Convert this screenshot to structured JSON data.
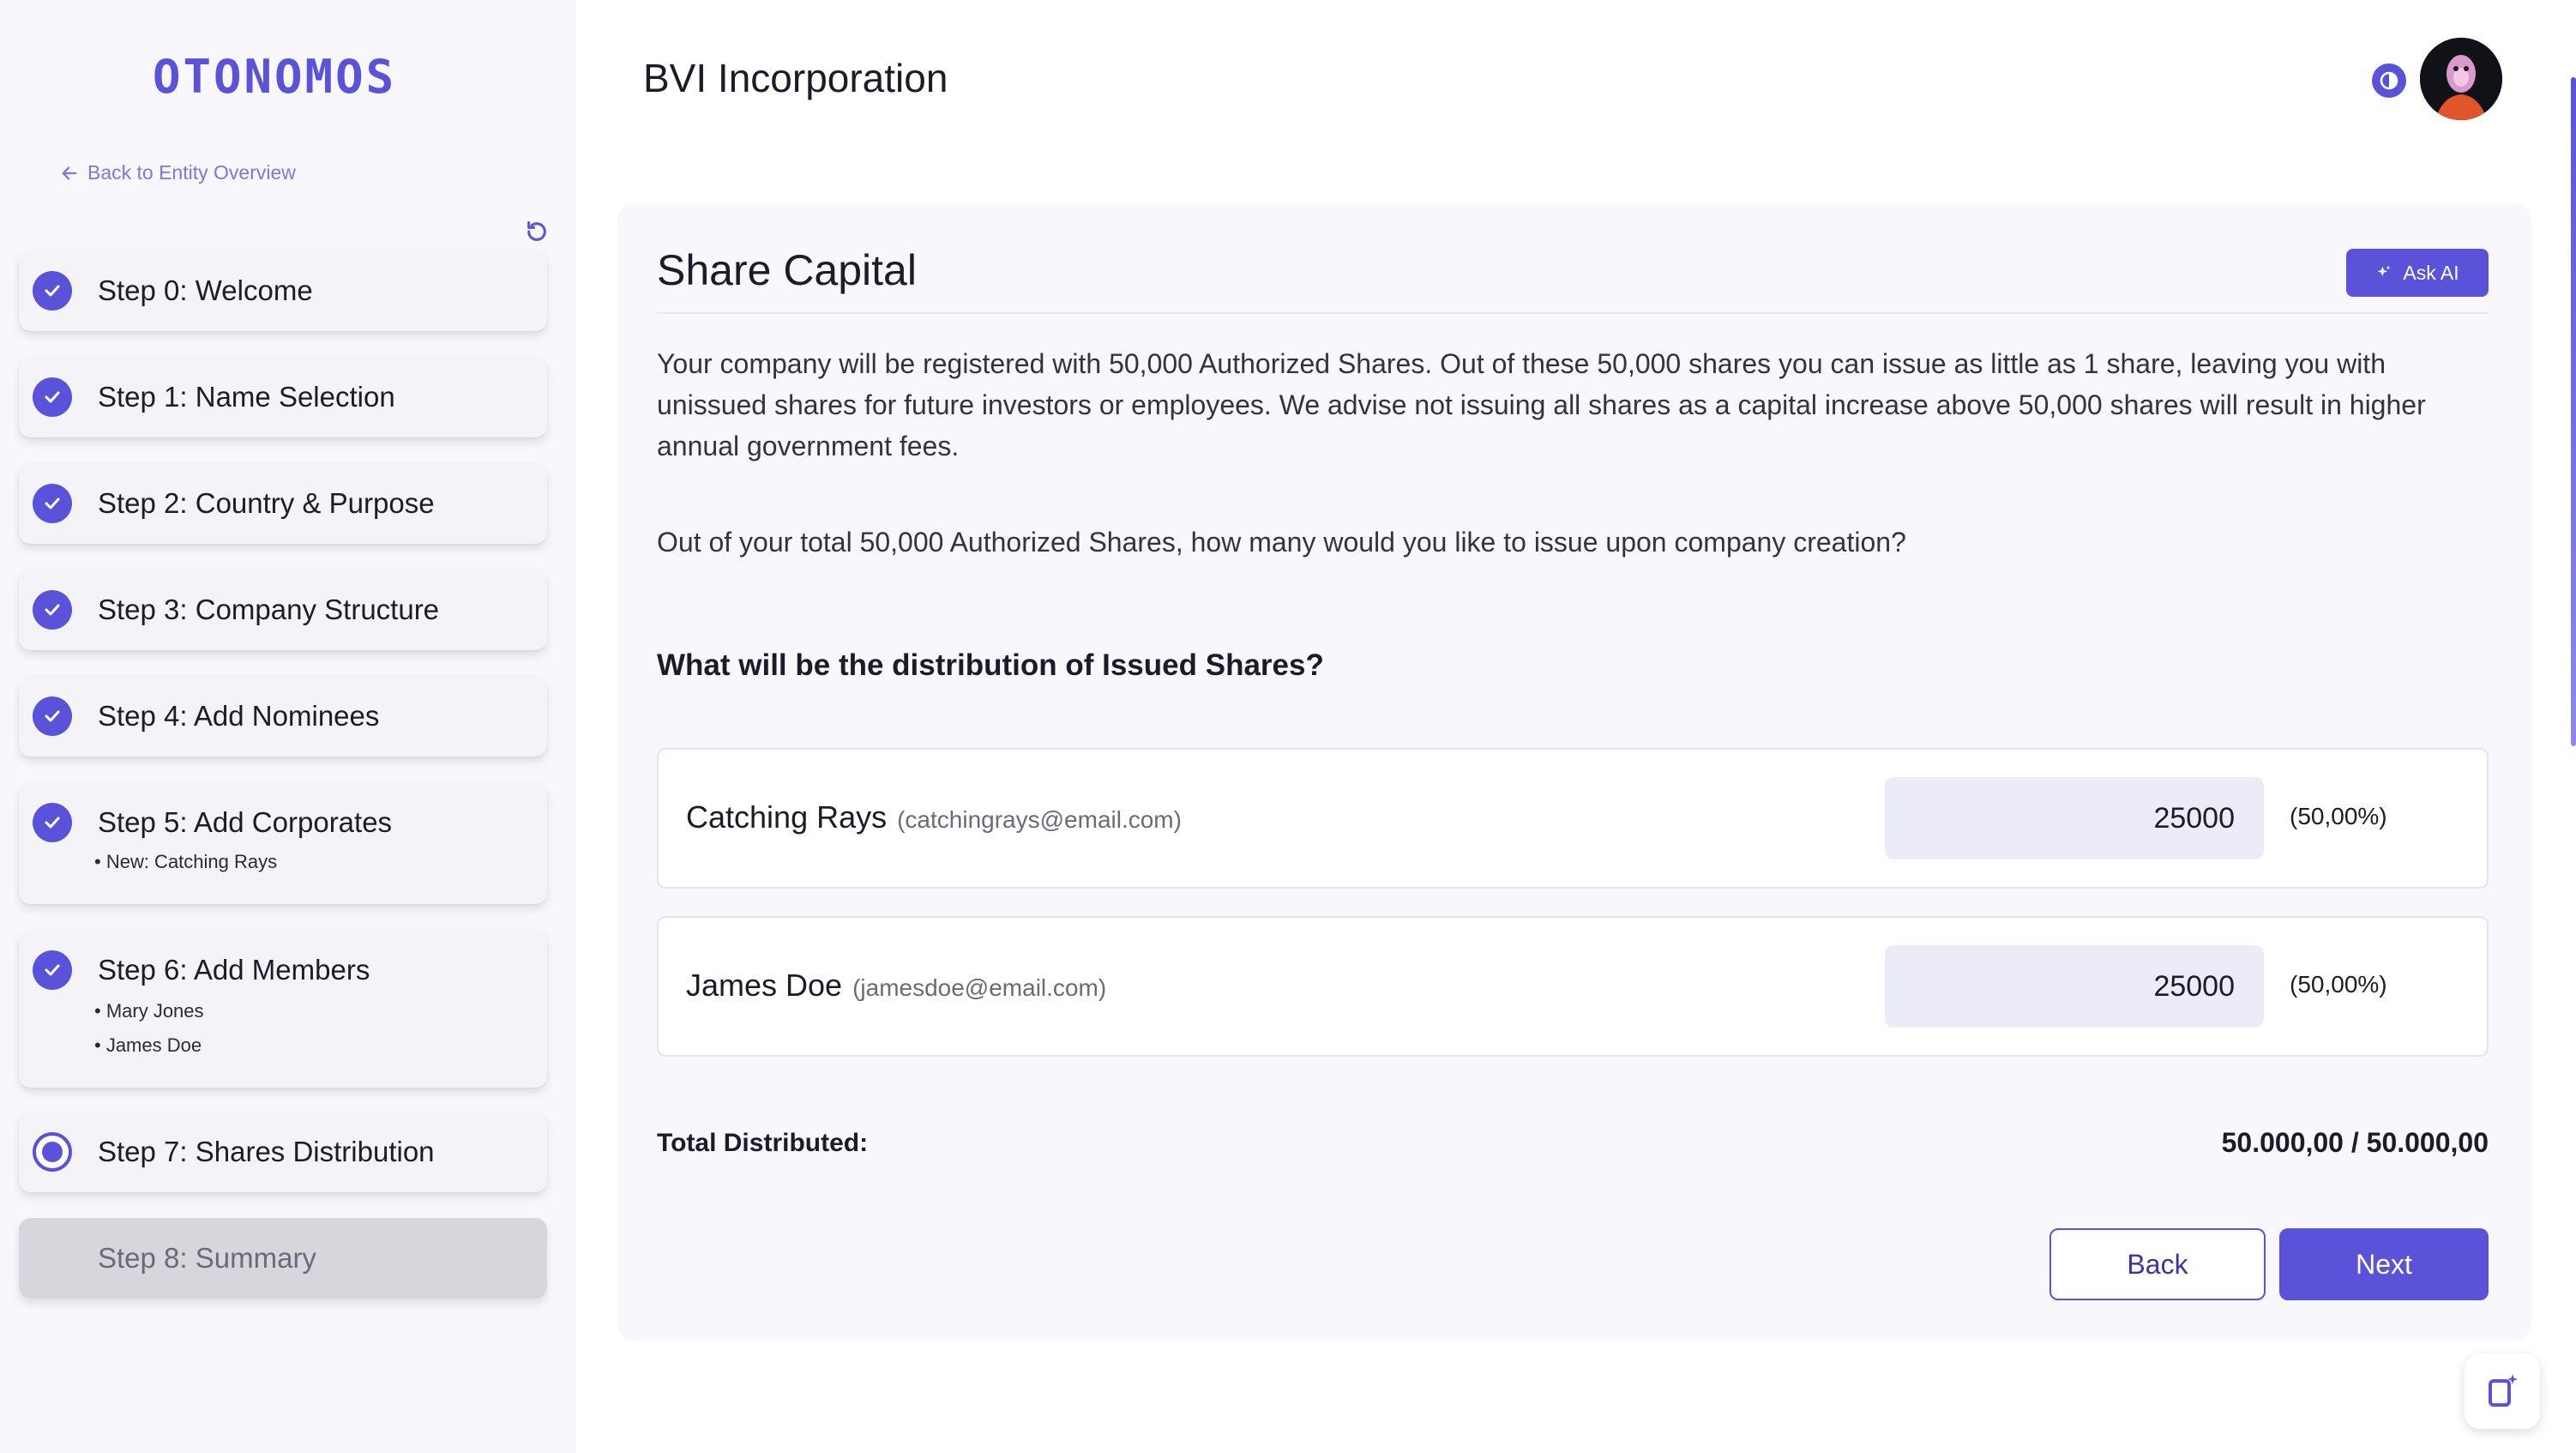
{
  "sidebar": {
    "logo": "OTONOMOS",
    "back_link": "Back to Entity Overview",
    "steps": [
      {
        "label": "Step 0: Welcome",
        "state": "done"
      },
      {
        "label": "Step 1: Name Selection",
        "state": "done"
      },
      {
        "label": "Step 2: Country & Purpose",
        "state": "done"
      },
      {
        "label": "Step 3: Company Structure",
        "state": "done"
      },
      {
        "label": "Step 4: Add Nominees",
        "state": "done"
      },
      {
        "label": "Step 5: Add Corporates",
        "state": "done",
        "subs": [
          "• New: Catching Rays"
        ]
      },
      {
        "label": "Step 6: Add Members",
        "state": "done",
        "subs": [
          "• Mary Jones",
          "• James Doe"
        ]
      },
      {
        "label": "Step 7: Shares Distribution",
        "state": "current"
      },
      {
        "label": "Step 8: Summary",
        "state": "disabled"
      }
    ]
  },
  "header": {
    "title": "BVI Incorporation"
  },
  "card": {
    "title": "Share Capital",
    "ask_ai": "Ask AI",
    "paragraph": "Your company will be registered with 50,000 Authorized Shares. Out of these 50,000 shares you can issue as little as 1 share, leaving you with unissued shares for future investors or employees. We advise not issuing all shares as a capital increase above 50,000 shares will result in higher annual government fees.",
    "prompt": "Out of your total 50,000 Authorized Shares, how many would you like to issue upon company creation?",
    "question": "What will be the distribution of Issued Shares?",
    "members": [
      {
        "name": "Catching Rays",
        "email": "(catchingrays@email.com)",
        "shares": "25000",
        "percent": "(50,00%)"
      },
      {
        "name": "James Doe",
        "email": "(jamesdoe@email.com)",
        "shares": "25000",
        "percent": "(50,00%)"
      }
    ],
    "total_label": "Total Distributed:",
    "total_value": "50.000,00 / 50.000,00",
    "back_button": "Back",
    "next_button": "Next"
  },
  "icons": {
    "theme_toggle": "half-circle-icon",
    "avatar": "avatar",
    "help": "help-widget-icon"
  },
  "colors": {
    "accent": "#5a52d8",
    "sidebar_bg": "#f8f8fc",
    "card_bg": "#f8f8fc",
    "input_bg": "#ececf8",
    "disabled_step": "#d6d6dc"
  }
}
